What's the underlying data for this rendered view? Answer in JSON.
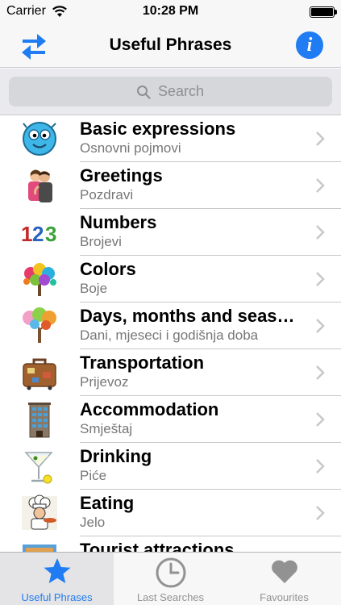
{
  "status_bar": {
    "carrier": "Carrier",
    "time": "10:28 PM"
  },
  "nav": {
    "title": "Useful Phrases",
    "info_label": "i"
  },
  "search": {
    "placeholder": "Search"
  },
  "categories": [
    {
      "title": "Basic expressions",
      "subtitle": "Osnovni pojmovi",
      "icon": "smiley-face-icon"
    },
    {
      "title": "Greetings",
      "subtitle": "Pozdravi",
      "icon": "hugging-people-icon"
    },
    {
      "title": "Numbers",
      "subtitle": "Brojevi",
      "icon": "numbers-123-icon"
    },
    {
      "title": "Colors",
      "subtitle": "Boje",
      "icon": "colorful-tree-icon"
    },
    {
      "title": "Days, months and seasons",
      "subtitle": "Dani, mjeseci i godišnja doba",
      "icon": "seasons-tree-icon"
    },
    {
      "title": "Transportation",
      "subtitle": "Prijevoz",
      "icon": "suitcase-icon"
    },
    {
      "title": "Accommodation",
      "subtitle": "Smještaj",
      "icon": "hotel-building-icon"
    },
    {
      "title": "Drinking",
      "subtitle": "Piće",
      "icon": "cocktail-glass-icon"
    },
    {
      "title": "Eating",
      "subtitle": "Jelo",
      "icon": "chef-icon"
    },
    {
      "title": "Tourist attractions",
      "subtitle": "",
      "icon": "tourist-attraction-icon"
    }
  ],
  "tabs": [
    {
      "label": "Useful Phrases",
      "icon": "star-icon",
      "active": true
    },
    {
      "label": "Last Searches",
      "icon": "clock-icon",
      "active": false
    },
    {
      "label": "Favourites",
      "icon": "heart-icon",
      "active": false
    }
  ],
  "colors": {
    "accent": "#1f7cf2",
    "inactive": "#929292"
  }
}
